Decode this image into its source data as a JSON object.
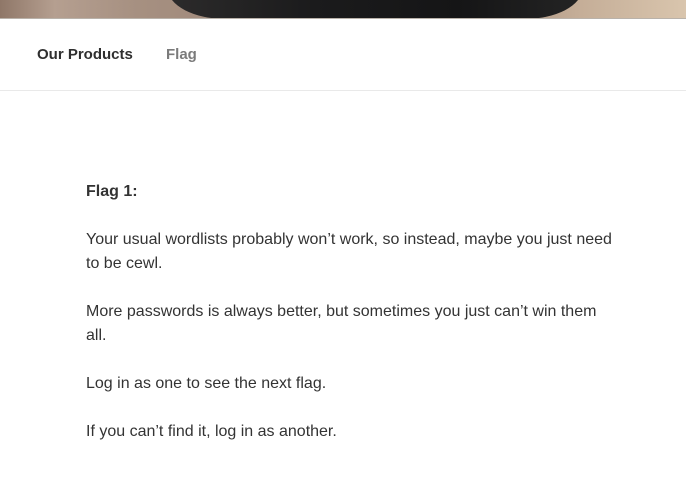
{
  "nav": {
    "items": [
      {
        "label": "Our Products"
      },
      {
        "label": "Flag"
      }
    ]
  },
  "content": {
    "title": "Flag 1:",
    "paragraphs": [
      "Your usual wordlists probably won’t work, so instead, maybe you just need to be cewl.",
      "More passwords is always better, but sometimes you just can’t win them all.",
      "Log in as one to see the next flag.",
      "If you can’t find it, log in as another."
    ]
  },
  "colors": {
    "text": "#333333",
    "inactive_nav": "#7b7b7b",
    "header_image_dark": "#151516"
  }
}
